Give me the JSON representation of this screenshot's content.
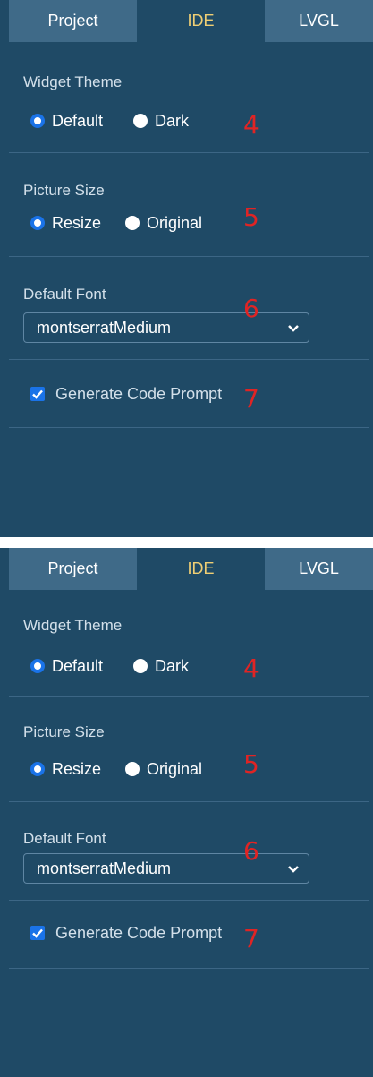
{
  "tabs": [
    "Project",
    "IDE",
    "LVGL"
  ],
  "widget_theme": {
    "label": "Widget Theme",
    "options": [
      "Default",
      "Dark"
    ],
    "selected": "Default"
  },
  "picture_size": {
    "label": "Picture Size",
    "options": [
      "Resize",
      "Original"
    ],
    "selected": "Resize"
  },
  "default_font": {
    "label": "Default Font",
    "value": "montserratMedium"
  },
  "generate_code_prompt": {
    "label": "Generate Code Prompt",
    "checked": true
  },
  "annotations": [
    "4",
    "5",
    "6",
    "7"
  ],
  "colors": {
    "panel_bg": "#1f4a66",
    "tab_inactive": "#3f6a88",
    "tab_active_text": "#f0cf74",
    "accent": "#1a73e8",
    "annotation": "#e02424"
  },
  "icons": [
    "radio-selected-icon",
    "radio-unselected-icon",
    "chevron-down-icon",
    "checkbox-checked-icon"
  ]
}
